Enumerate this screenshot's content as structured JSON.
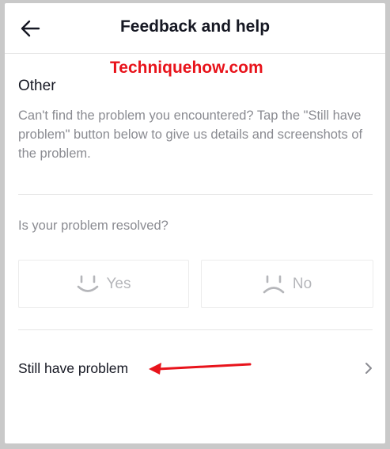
{
  "header": {
    "title": "Feedback and help",
    "back_icon": "arrow-left-icon"
  },
  "watermark": "Techniquehow.com",
  "section": {
    "title": "Other",
    "description": "Can't find the problem you encountered? Tap the \"Still have problem\" button below to give us details and screenshots of the problem."
  },
  "feedback": {
    "question": "Is your problem resolved?",
    "yes_label": "Yes",
    "no_label": "No"
  },
  "still_problem": {
    "label": "Still have problem"
  },
  "colors": {
    "watermark": "#e8131b",
    "text_primary": "#161823",
    "text_secondary": "#8a8b91"
  }
}
